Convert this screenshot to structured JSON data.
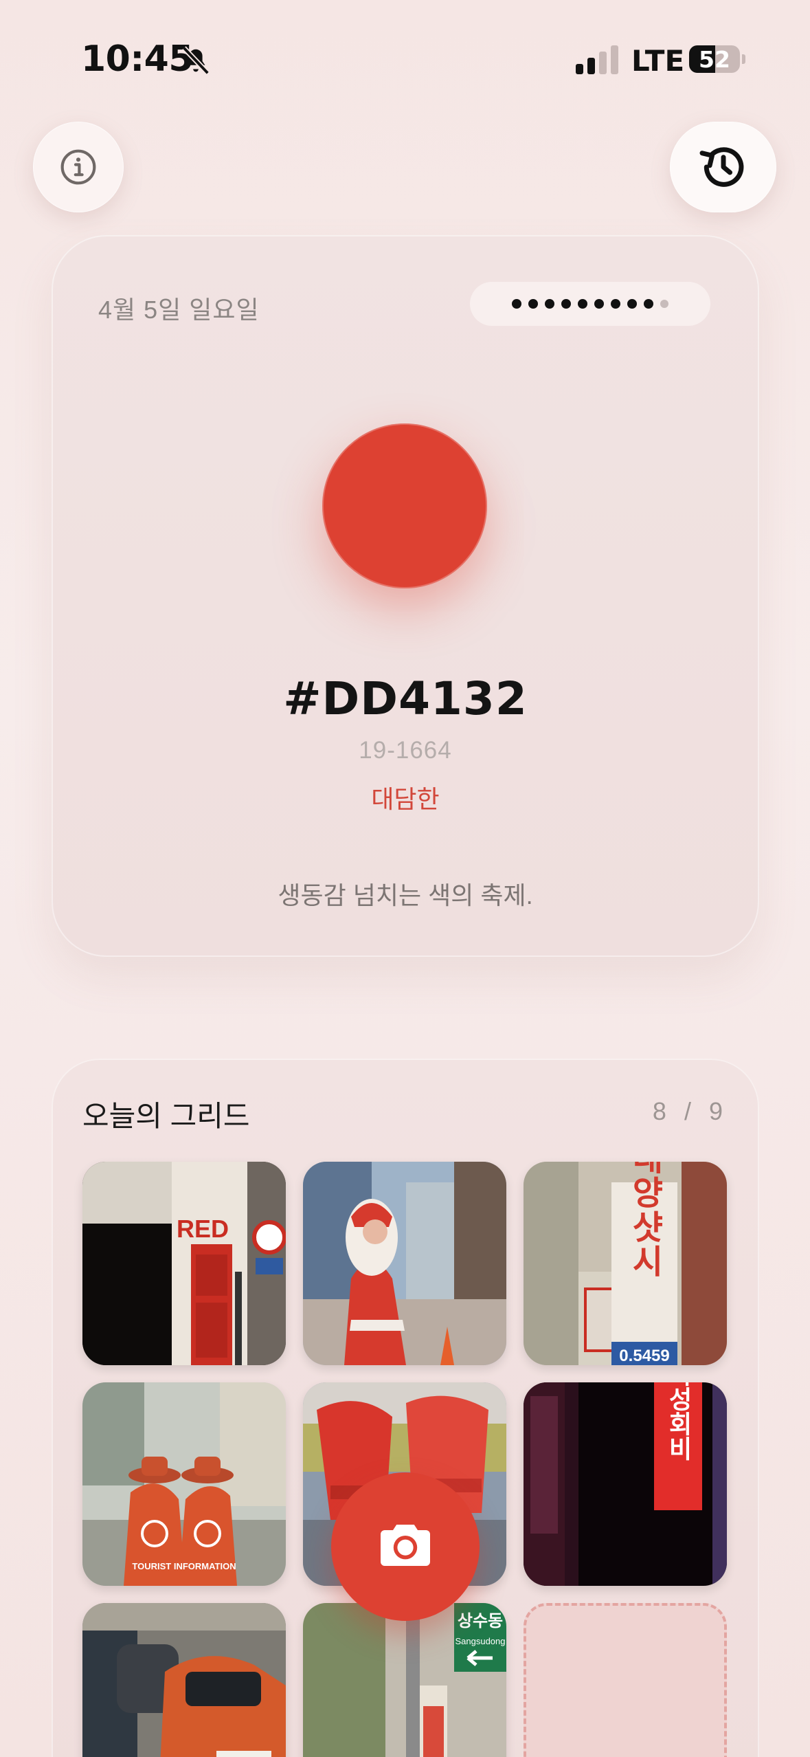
{
  "status_bar": {
    "time": "10:45",
    "network": "LTE",
    "battery_percent": "52",
    "battery_level": 0.52,
    "signal_bars": 2,
    "signal_max": 4
  },
  "header": {
    "info_icon": "info-circle-icon",
    "history_icon": "history-clock-icon"
  },
  "color_card": {
    "date": "4월 5일 일요일",
    "progress_total": 10,
    "progress_filled": 9,
    "swatch_color": "#DD4132",
    "hex_code": "#DD4132",
    "pantone_code": "19-1664",
    "mood_word": "대담한",
    "tagline": "생동감 넘치는 색의 축제."
  },
  "grid": {
    "title": "오늘의 그리드",
    "count_filled": "8",
    "count_separator": "/",
    "count_total": "9",
    "photos": [
      {
        "name": "red-door-storefront",
        "sign": "RED"
      },
      {
        "name": "santa-statue-street",
        "sign": ""
      },
      {
        "name": "korean-vertical-sign",
        "sign": "태양샷시",
        "sign_bottom": "0.5459"
      },
      {
        "name": "tourist-information-guides",
        "sign": "TOURIST INFORMATION"
      },
      {
        "name": "red-plastic-chairs",
        "sign": ""
      },
      {
        "name": "neon-vertical-sign",
        "sign": "육성회비"
      },
      {
        "name": "orange-car-street",
        "sign": ""
      },
      {
        "name": "street-sign-sangsudong",
        "sign": "상수동",
        "sign_bottom": "Sangsudong"
      },
      {
        "name": "empty-slot",
        "sign": ""
      }
    ]
  },
  "camera_button_icon": "camera-icon",
  "colors": {
    "accent": "#DD4132",
    "background": "#F6E9E8"
  }
}
